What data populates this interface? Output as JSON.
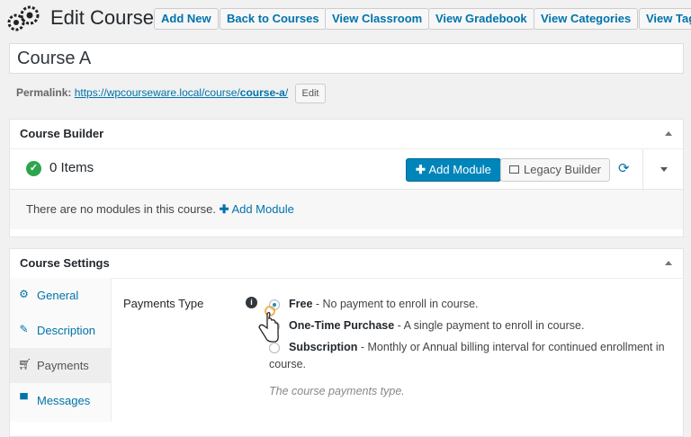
{
  "header": {
    "title": "Edit Course",
    "buttons": [
      "Add New",
      "Back to Courses",
      "View Classroom",
      "View Gradebook",
      "View Categories",
      "View Tag"
    ]
  },
  "title_field": {
    "value": "Course A"
  },
  "permalink": {
    "label": "Permalink:",
    "url_base": "https://wpcourseware.local/course/",
    "slug": "course-a",
    "url_end": "/",
    "edit_label": "Edit"
  },
  "course_builder": {
    "title": "Course Builder",
    "items_count": "0 Items",
    "add_module_label": "Add Module",
    "legacy_builder_label": "Legacy Builder",
    "empty_text": "There are no modules in this course.",
    "empty_link": "Add Module"
  },
  "course_settings": {
    "title": "Course Settings",
    "tabs": [
      {
        "label": "General",
        "icon": "gear-icon"
      },
      {
        "label": "Description",
        "icon": "edit-icon"
      },
      {
        "label": "Payments",
        "icon": "cart-icon"
      },
      {
        "label": "Messages",
        "icon": "speech-bubble-icon"
      }
    ],
    "active_tab": "Payments",
    "payments": {
      "field_label": "Payments Type",
      "options": [
        {
          "name": "Free",
          "desc": " - No payment to enroll in course.",
          "checked": true
        },
        {
          "name": "One-Time Purchase",
          "desc": " - A single payment to enroll in course.",
          "checked": false
        },
        {
          "name": "Subscription",
          "desc": " - Monthly or Annual billing interval for continued enrollment in course.",
          "checked": false
        }
      ],
      "help_text": "The course payments type."
    }
  },
  "colors": {
    "primary_button": "#0085ba",
    "link": "#0073aa",
    "success": "#2ea44f"
  }
}
